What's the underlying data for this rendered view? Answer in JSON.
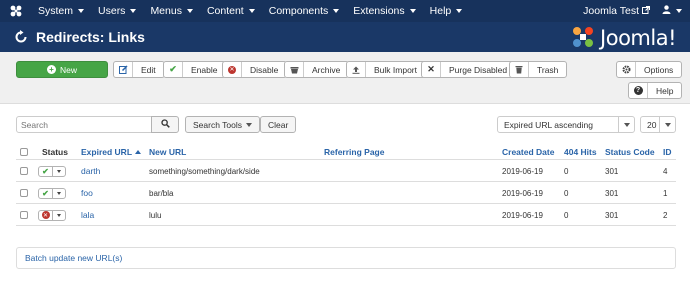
{
  "topnav": {
    "menu": [
      {
        "label": "System"
      },
      {
        "label": "Users"
      },
      {
        "label": "Menus"
      },
      {
        "label": "Content"
      },
      {
        "label": "Components"
      },
      {
        "label": "Extensions"
      },
      {
        "label": "Help"
      }
    ],
    "site_name": "Joomla Test"
  },
  "header": {
    "title": "Redirects: Links",
    "brand": "Joomla!"
  },
  "toolbar": {
    "new": "New",
    "edit": "Edit",
    "enable": "Enable",
    "disable": "Disable",
    "archive": "Archive",
    "bulk_import": "Bulk Import",
    "purge_disabled": "Purge Disabled",
    "trash": "Trash",
    "options": "Options",
    "help": "Help"
  },
  "filters": {
    "search_placeholder": "Search",
    "search_tools": "Search Tools",
    "clear": "Clear",
    "ordering": "Expired URL ascending",
    "limit": "20"
  },
  "table": {
    "columns": {
      "status": "Status",
      "expired_url": "Expired URL",
      "new_url": "New URL",
      "referring_page": "Referring Page",
      "created_date": "Created Date",
      "hits": "404 Hits",
      "status_code": "Status Code",
      "id": "ID"
    },
    "rows": [
      {
        "enabled": true,
        "expired_url": "darth",
        "new_url": "something/something/dark/side",
        "referring_page": "",
        "created_date": "2019-06-19",
        "hits": "0",
        "status_code": "301",
        "id": "4"
      },
      {
        "enabled": true,
        "expired_url": "foo",
        "new_url": "bar/bla",
        "referring_page": "",
        "created_date": "2019-06-19",
        "hits": "0",
        "status_code": "301",
        "id": "1"
      },
      {
        "enabled": false,
        "expired_url": "lala",
        "new_url": "lulu",
        "referring_page": "",
        "created_date": "2019-06-19",
        "hits": "0",
        "status_code": "301",
        "id": "2"
      }
    ]
  },
  "batch": {
    "label": "Batch update new URL(s)"
  },
  "colors": {
    "nav_bg": "#17325c",
    "header_bg": "#1a3867",
    "new_button": "#46a546",
    "link": "#2a64a8",
    "disabled": "#bd362f"
  }
}
